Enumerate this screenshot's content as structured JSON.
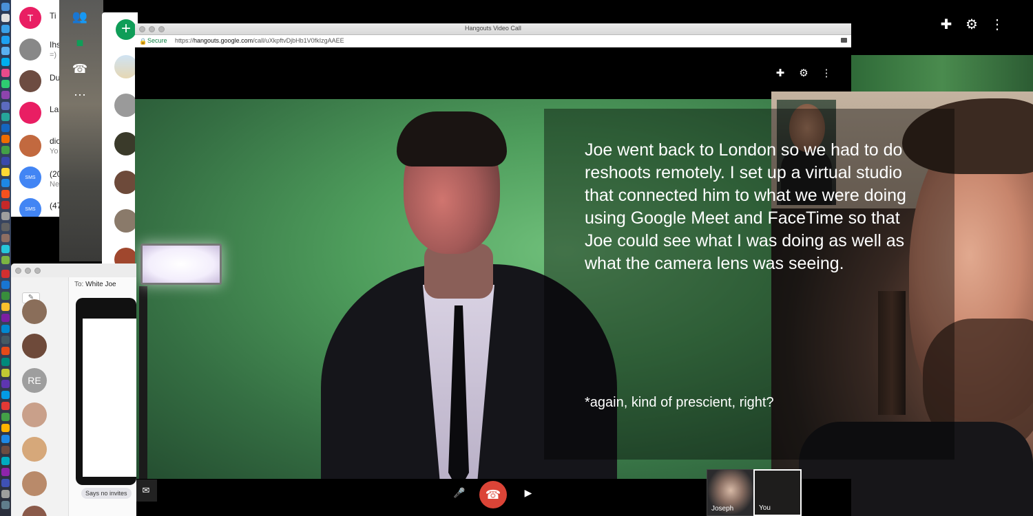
{
  "browser": {
    "window_title": "Hangouts Video Call",
    "secure_label": "Secure",
    "url_prefix": "https://",
    "url_domain": "hangouts.google.com",
    "url_path": "/call/uXkpftvDjbHb1V0fkIzgAAEE"
  },
  "caption": {
    "text": "Joe went back to London so we had to do reshoots remotely. I set up a virtual studio that connected him to what we were doing using Google Meet and FaceTime so that Joe could see what I was doing as well as what the camera lens was seeing.",
    "note": "*again, kind of prescient, right?"
  },
  "participants": [
    {
      "label": "Joseph"
    },
    {
      "label": "You"
    }
  ],
  "contacts": [
    {
      "initial": "T",
      "name": "Ti",
      "color": "#e91e63"
    },
    {
      "initial": "",
      "name": "Ihs",
      "sub": "=)",
      "color": "#888888"
    },
    {
      "initial": "",
      "name": "Du",
      "color": "#6d4c41"
    },
    {
      "initial": "",
      "name": "La",
      "color": "#e91e63"
    },
    {
      "initial": "",
      "name": "dio",
      "sub": "Yo",
      "color": "#c2693f"
    },
    {
      "initial": "SMS",
      "name": "(20",
      "sub": "Ne",
      "color": "#4285f4"
    },
    {
      "initial": "SMS",
      "name": "(47",
      "color": "#4285f4"
    }
  ],
  "messages": {
    "to_label": "To:",
    "to_name": "White Joe",
    "compose_icon": "compose-icon",
    "avatar_initials": "RE",
    "bubble_text": "Says no invites"
  },
  "icons": {
    "add_person": "add-person-icon",
    "settings": "gear-icon",
    "more": "more-vert-icon",
    "mic": "mic-icon",
    "hangup": "hangup-icon",
    "video": "videocam-icon",
    "chat": "chat-icon"
  },
  "colors": {
    "hangup_red": "#db4437",
    "hangouts_green": "#0f9d58",
    "secure_green": "#0b8043"
  }
}
